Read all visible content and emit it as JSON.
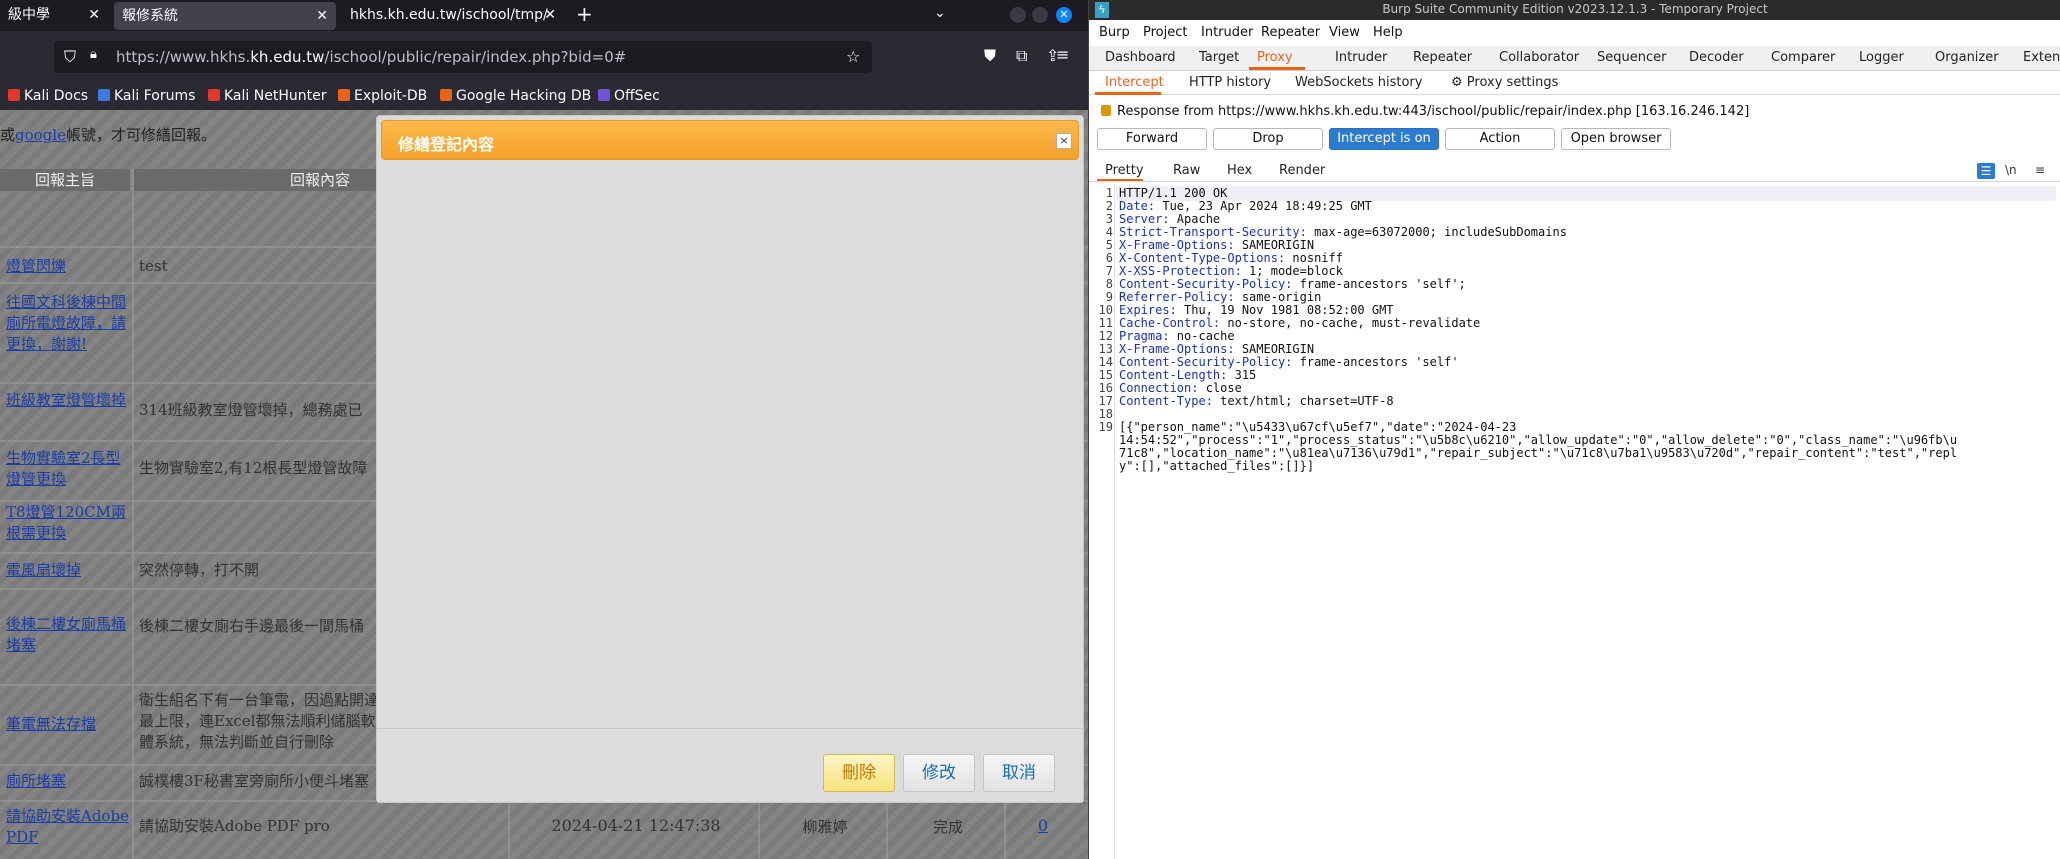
{
  "firefox": {
    "tabs": [
      {
        "label": "級中學"
      },
      {
        "label": "報修系統"
      },
      {
        "label": "hkhs.kh.edu.tw/ischool/tmp/"
      }
    ],
    "url_prefix": "https://www.hkhs.",
    "url_domain": "kh.edu.tw",
    "url_suffix": "/ischool/public/repair/index.php?bid=0#",
    "bookmarks": [
      {
        "label": "Kali Docs",
        "color": "#e0382b"
      },
      {
        "label": "Kali Forums",
        "color": "#3b7bd9"
      },
      {
        "label": "Kali NetHunter",
        "color": "#e0382b"
      },
      {
        "label": "Exploit-DB",
        "color": "#e8641b"
      },
      {
        "label": "Google Hacking DB",
        "color": "#e8641b"
      },
      {
        "label": "OffSec",
        "color": "#6f55d6"
      }
    ]
  },
  "page": {
    "hint_prefix": "或",
    "hint_link": "google",
    "hint_suffix": "帳號，才可修繕回報。",
    "headers": {
      "subject": "回報主旨",
      "content": "回報內容"
    },
    "rows": [
      {
        "subject": "燈管閃爍",
        "content": "test",
        "date": "",
        "person": "",
        "status": "",
        "count": ""
      },
      {
        "subject": "往國文科後棟中間廁所電燈故障，請更換，謝謝!",
        "content": "",
        "date": "",
        "person": "",
        "status": "",
        "count": ""
      },
      {
        "subject": "班級教室燈管壞掉",
        "content": "314班級教室燈管壞掉，總務處已",
        "date": "",
        "person": "",
        "status": "",
        "count": ""
      },
      {
        "subject": "生物實驗室2長型燈管更換",
        "content": "生物實驗室2,有12根長型燈管故障",
        "date": "",
        "person": "",
        "status": "",
        "count": ""
      },
      {
        "subject": "T8燈管120CM兩根需更換",
        "content": "",
        "date": "",
        "person": "",
        "status": "",
        "count": ""
      },
      {
        "subject": "電風扇壞掉",
        "content": "突然停轉，打不開",
        "date": "",
        "person": "",
        "status": "",
        "count": ""
      },
      {
        "subject": "後棟二樓女廁馬桶堵塞",
        "content": "後棟二樓女廁右手邊最後一間馬桶",
        "date": "",
        "person": "",
        "status": "",
        "count": ""
      },
      {
        "subject": "筆電無法存檔",
        "content": "衛生組名下有一台筆電，因過點開達最上限，連Excel都無法順利儲腦軟體系統，無法判斷並自行刪除",
        "date": "",
        "person": "",
        "status": "",
        "count": ""
      },
      {
        "subject": "廁所堵塞",
        "content": "誠樸樓3F秘書室旁廁所小便斗堵塞",
        "date": "",
        "person": "",
        "status": "",
        "count": ""
      },
      {
        "subject": "請協助安裝Adobe PDF",
        "content": "請協助安裝Adobe PDF pro",
        "date": "2024-04-21 12:47:38",
        "person": "柳雅婷",
        "status": "完成",
        "count": "0"
      }
    ],
    "modal": {
      "title": "修繕登記內容",
      "close": "×",
      "delete": "刪除",
      "edit": "修改",
      "cancel": "取消"
    }
  },
  "burp": {
    "title": "Burp Suite Community Edition v2023.12.1.3 - Temporary Project",
    "menu": [
      "Burp",
      "Project",
      "Intruder",
      "Repeater",
      "View",
      "Help"
    ],
    "tabs": [
      "Dashboard",
      "Target",
      "Proxy",
      "Intruder",
      "Repeater",
      "Collaborator",
      "Sequencer",
      "Decoder",
      "Comparer",
      "Logger",
      "Organizer",
      "Extens"
    ],
    "subtabs": [
      "Intercept",
      "HTTP history",
      "WebSockets history",
      "Proxy settings"
    ],
    "response_from": "Response from https://www.hkhs.kh.edu.tw:443/ischool/public/repair/index.php  [163.16.246.142]",
    "buttons": {
      "forward": "Forward",
      "drop": "Drop",
      "intercept": "Intercept is on",
      "action": "Action",
      "open_browser": "Open browser"
    },
    "viewtabs": [
      "Pretty",
      "Raw",
      "Hex",
      "Render"
    ],
    "view_icons": {
      "newline": "\\n",
      "menu": "≡"
    },
    "lines": [
      {
        "n": "1",
        "key": "",
        "val": "HTTP/1.1 200 OK"
      },
      {
        "n": "2",
        "key": "Date:",
        "val": " Tue, 23 Apr 2024 18:49:25 GMT"
      },
      {
        "n": "3",
        "key": "Server:",
        "val": " Apache"
      },
      {
        "n": "4",
        "key": "Strict-Transport-Security:",
        "val": " max-age=63072000; includeSubDomains"
      },
      {
        "n": "5",
        "key": "X-Frame-Options:",
        "val": " SAMEORIGIN"
      },
      {
        "n": "6",
        "key": "X-Content-Type-Options:",
        "val": " nosniff"
      },
      {
        "n": "7",
        "key": "X-XSS-Protection:",
        "val": " 1; mode=block"
      },
      {
        "n": "8",
        "key": "Content-Security-Policy:",
        "val": " frame-ancestors 'self';"
      },
      {
        "n": "9",
        "key": "Referrer-Policy:",
        "val": " same-origin"
      },
      {
        "n": "10",
        "key": "Expires:",
        "val": " Thu, 19 Nov 1981 08:52:00 GMT"
      },
      {
        "n": "11",
        "key": "Cache-Control:",
        "val": " no-store, no-cache, must-revalidate"
      },
      {
        "n": "12",
        "key": "Pragma:",
        "val": " no-cache"
      },
      {
        "n": "13",
        "key": "X-Frame-Options:",
        "val": " SAMEORIGIN"
      },
      {
        "n": "14",
        "key": "Content-Security-Policy:",
        "val": " frame-ancestors 'self'"
      },
      {
        "n": "15",
        "key": "Content-Length:",
        "val": " 315"
      },
      {
        "n": "16",
        "key": "Connection:",
        "val": " close"
      },
      {
        "n": "17",
        "key": "Content-Type:",
        "val": " text/html; charset=UTF-8"
      },
      {
        "n": "18",
        "key": "",
        "val": ""
      },
      {
        "n": "19",
        "key": "",
        "val": "[{\"person_name\":\"\\u5433\\u67cf\\u5ef7\",\"date\":\"2024-04-23"
      }
    ],
    "body_cont": [
      "14:54:52\",\"process\":\"1\",\"process_status\":\"\\u5b8c\\u6210\",\"allow_update\":\"0\",\"allow_delete\":\"0\",\"class_name\":\"\\u96fb\\u",
      "71c8\",\"location_name\":\"\\u81ea\\u7136\\u79d1\",\"repair_subject\":\"\\u71c8\\u7ba1\\u9583\\u720d\",\"repair_content\":\"test\",\"repl",
      "y\":[],\"attached_files\":[]}]"
    ]
  }
}
